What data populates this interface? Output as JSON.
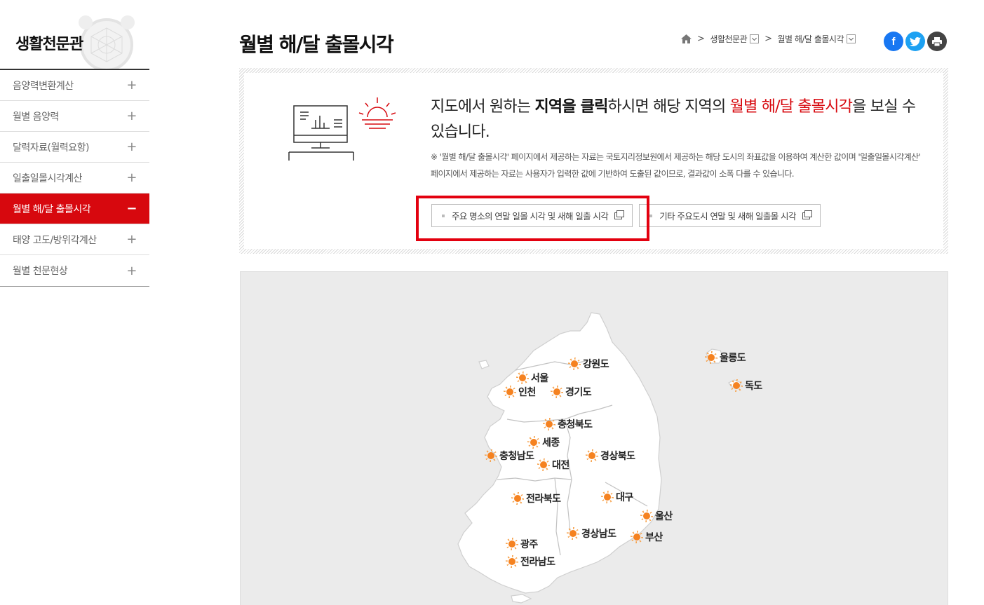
{
  "sidebar": {
    "title": "생활천문관",
    "items": [
      {
        "label": "음양력변환계산",
        "toggle": "+"
      },
      {
        "label": "월별 음양력",
        "toggle": "+"
      },
      {
        "label": "달력자료(월력요항)",
        "toggle": "+"
      },
      {
        "label": "일출일몰시각계산",
        "toggle": "+"
      },
      {
        "label": "월별 해/달 출몰시각",
        "toggle": "−"
      },
      {
        "label": "태양 고도/방위각계산",
        "toggle": "+"
      },
      {
        "label": "월별 천문현상",
        "toggle": "+"
      }
    ],
    "active_index": 4
  },
  "header": {
    "title": "월별 해/달 출몰시각",
    "breadcrumb": [
      "생활천문관",
      "월별 해/달 출몰시각"
    ],
    "sep": ">",
    "social": {
      "facebook": "f",
      "twitter": "t",
      "print": "⎙"
    }
  },
  "info": {
    "lead_1": "지도에서 원하는 ",
    "lead_bold": "지역을 클릭",
    "lead_2": "하시면 해당 지역의 ",
    "lead_red": "월별 해/달 출몰시각",
    "lead_3": "을 보실 수 있습니다.",
    "note": "※ '월별 해/달 출몰시각' 페이지에서 제공하는 자료는 국토지리정보원에서 제공하는 해당 도시의 좌표값을 이용하여 계산한 값이며 '일출일몰시각계산' 페이지에서 제공하는 자료는 사용자가 입력한 값에 기반하여 도출된 값이므로, 결과값이 소폭 다를 수 있습니다.",
    "buttons": [
      {
        "label": "주요 명소의 연말 일몰 시각 및 새해 일출 시각"
      },
      {
        "label": "기타 주요도시 연말 및 새해 일출몰 시각"
      }
    ]
  },
  "map": {
    "cities": [
      "강원도",
      "서울",
      "인천",
      "경기도",
      "충청북도",
      "세종",
      "충청남도",
      "대전",
      "경상북도",
      "대구",
      "전라북도",
      "울산",
      "경상남도",
      "부산",
      "광주",
      "전라남도",
      "울릉도",
      "독도"
    ],
    "sun_color": "#f58220"
  },
  "colors": {
    "accent": "#d7080e",
    "facebook": "#1877f2",
    "twitter": "#1da1f2",
    "print": "#444444"
  }
}
